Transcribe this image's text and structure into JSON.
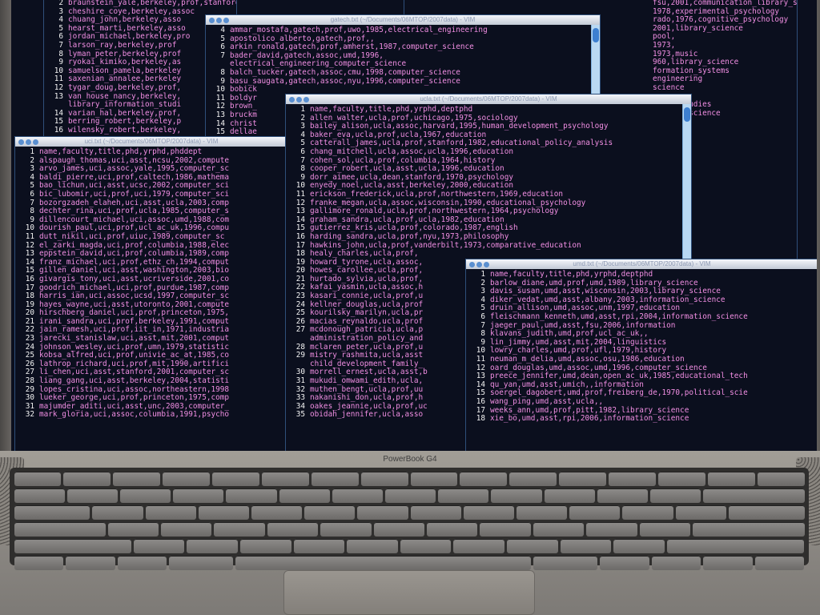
{
  "brand": "PowerBook G4",
  "windows": {
    "top_left": {
      "lines": [
        {
          "n": "2",
          "t": "braunstein_yale,berkeley,prof,stanford,1975,economics"
        },
        {
          "n": "3",
          "t": "cheshire_coye,berkeley,assoc"
        },
        {
          "n": "4",
          "t": "chuang_john,berkeley,asso"
        },
        {
          "n": "5",
          "t": "hearst_marti,berkeley,asso"
        },
        {
          "n": "6",
          "t": "jordan_michael,berkeley,pro"
        },
        {
          "n": "7",
          "t": "larson_ray,berkeley,prof"
        },
        {
          "n": "8",
          "t": "lyman_peter,berkeley,prof"
        },
        {
          "n": "9",
          "t": "ryokai_kimiko,berkeley,as"
        },
        {
          "n": "10",
          "t": "samuelson_pamela,berkeley"
        },
        {
          "n": "11",
          "t": "saxenian_annalee,berkeley"
        },
        {
          "n": "12",
          "t": "tygar_doug,berkeley,prof,"
        },
        {
          "n": "13",
          "t": "van_house_nancy,berkeley,"
        },
        {
          "n": "",
          "t": "library_information_studi"
        },
        {
          "n": "14",
          "t": "varian_hal,berkeley,prof,"
        },
        {
          "n": "15",
          "t": "berring_robert,berkeley,p"
        },
        {
          "n": "16",
          "t": "wilensky_robert,berkeley,"
        }
      ]
    },
    "top_right": {
      "lines": [
        {
          "n": "",
          "t": "fsu,2001,communication_library_science"
        },
        {
          "n": "",
          "t": "1978,experimental_psychology"
        },
        {
          "n": "",
          "t": "rado,1976,cognitive_psychology"
        },
        {
          "n": "",
          "t": "2001,library_science"
        },
        {
          "n": "",
          "t": "pool,"
        },
        {
          "n": "",
          "t": "1973,"
        },
        {
          "n": "",
          "t": "1973,music"
        },
        {
          "n": "",
          "t": "960,library_science"
        },
        {
          "n": "",
          "t": "formation_systems"
        },
        {
          "n": "",
          "t": "engineering"
        },
        {
          "n": "",
          "t": "science"
        },
        {
          "n": "",
          "t": "ce"
        },
        {
          "n": "",
          "t": ""
        },
        {
          "n": "",
          "t": "ation_studies"
        },
        {
          "n": "",
          "t": "library_science"
        },
        {
          "n": "",
          "t": "ence"
        },
        {
          "n": "",
          "t": ""
        },
        {
          "n": "",
          "t": ""
        },
        {
          "n": "",
          "t": ""
        },
        {
          "n": "",
          "t": "ce"
        },
        {
          "n": "",
          "t": "sophy"
        },
        {
          "n": "",
          "t": "ence"
        },
        {
          "n": "",
          "t": "science"
        }
      ]
    },
    "gatech": {
      "title": "gatech.txt (~/Documents/06MTOP/2007data) - VIM",
      "lines": [
        {
          "n": "4",
          "t": "ammar_mostafa,gatech,prof,uwo,1985,electrical_engineering"
        },
        {
          "n": "5",
          "t": "apostolico_alberto,gatech,prof,,"
        },
        {
          "n": "6",
          "t": "arkin_ronald,gatech,prof,amherst,1987,computer_science"
        },
        {
          "n": "7",
          "t": "bader_david,gatech,assoc,umd,1996,"
        },
        {
          "n": "",
          "t": "electrical_engineering_computer_science"
        },
        {
          "n": "8",
          "t": "balch_tucker,gatech,assoc,cmu,1998,computer_science"
        },
        {
          "n": "9",
          "t": "basu_saugata,gatech,assoc,nyu,1996,computer_science"
        },
        {
          "n": "10",
          "t": "bobick"
        },
        {
          "n": "11",
          "t": "boldyr"
        },
        {
          "n": "12",
          "t": "brown_"
        },
        {
          "n": "13",
          "t": "bruckm"
        },
        {
          "n": "14",
          "t": "christ"
        },
        {
          "n": "15",
          "t": "dellae"
        }
      ]
    },
    "uci": {
      "title": "uci.txt (~/Documents/06MTOP/2007data) - VIM",
      "lines": [
        {
          "n": "1",
          "t": "name,faculty,title,phd,yrphd,phddept"
        },
        {
          "n": "2",
          "t": "alspaugh_thomas,uci,asst,ncsu,2002,compute"
        },
        {
          "n": "3",
          "t": "arvo_james,uci,assoc,yale,1995,computer_sc"
        },
        {
          "n": "4",
          "t": "baldi_pierre,uci,prof,caltech,1986,mathema"
        },
        {
          "n": "5",
          "t": "bao_lichun,uci,asst,ucsc,2002,computer_sci"
        },
        {
          "n": "6",
          "t": "bic_lubomir,uci,prof,uci,1979,computer_sci"
        },
        {
          "n": "7",
          "t": "bozorgzadeh_elaheh,uci,asst,ucla,2003,comp"
        },
        {
          "n": "8",
          "t": "dechter_rina,uci,prof,ucla,1985,computer_s"
        },
        {
          "n": "9",
          "t": "dillencourt_michael,uci,assoc,umd,1988,com"
        },
        {
          "n": "10",
          "t": "dourish_paul,uci,prof,ucl_ac_uk,1996,compu"
        },
        {
          "n": "11",
          "t": "dutt_nikil,uci,prof,uiuc,1989,computer_sc"
        },
        {
          "n": "12",
          "t": "el_zarki_magda,uci,prof,columbia,1988,elec"
        },
        {
          "n": "13",
          "t": "eppstein_david,uci,prof,columbia,1989,comp"
        },
        {
          "n": "14",
          "t": "franz_michael,uci,prof,ethz_ch,1994,comput"
        },
        {
          "n": "15",
          "t": "gillen_daniel,uci,asst,washington,2003,bio"
        },
        {
          "n": "16",
          "t": "givargis_tony,uci,asst,ucriverside,2001,co"
        },
        {
          "n": "17",
          "t": "goodrich_michael,uci,prof,purdue,1987,comp"
        },
        {
          "n": "18",
          "t": "harris_ian,uci,assoc,ucsd,1997,computer_sc"
        },
        {
          "n": "19",
          "t": "hayes_wayne,uci,asst,utoronto,2001,compute"
        },
        {
          "n": "20",
          "t": "hirschberg_daniel,uci,prof,princeton,1975,"
        },
        {
          "n": "21",
          "t": "irani_sandra,uci,prof,berkeley,1991,comput"
        },
        {
          "n": "22",
          "t": "jain_ramesh,uci,prof,iit_in,1971,industria"
        },
        {
          "n": "23",
          "t": "jarecki_stanislaw,uci,asst,mit,2001,comput"
        },
        {
          "n": "24",
          "t": "johnson_wesley,uci,prof,umn,1979,statistic"
        },
        {
          "n": "25",
          "t": "kobsa_alfred,uci,prof,univie_ac_at,1985,co"
        },
        {
          "n": "26",
          "t": "lathrop_richard,uci,prof,mit,1990,artifici"
        },
        {
          "n": "27",
          "t": "li_chen,uci,asst,stanford,2001,computer_sc"
        },
        {
          "n": "28",
          "t": "liang_gang,uci,asst,berkeley,2004,statisti"
        },
        {
          "n": "29",
          "t": "lopes_cristina,uci,assoc,northeastern,1998"
        },
        {
          "n": "30",
          "t": "lueker_george,uci,prof,princeton,1975,comp"
        },
        {
          "n": "31",
          "t": "majumder_aditi,uci,asst,unc,2003,computer_"
        },
        {
          "n": "32",
          "t": "mark_gloria,uci,assoc,columbia,1991,psycho"
        }
      ]
    },
    "ucla": {
      "title": "ucla.txt (~/Documents/06MTOP/2007data) - VIM",
      "lines": [
        {
          "n": "1",
          "t": "name,faculty,title,phd,yrphd,deptphd"
        },
        {
          "n": "2",
          "t": "allen_walter,ucla,prof,uchicago,1975,sociology"
        },
        {
          "n": "3",
          "t": "bailey_alison,ucla,assoc,harvard,1995,human_development_psychology"
        },
        {
          "n": "4",
          "t": "baker_eva,ucla,prof,ucla,1967,education"
        },
        {
          "n": "5",
          "t": "catterall_james,ucla,prof,stanford,1982,educational_policy_analysis"
        },
        {
          "n": "6",
          "t": "chang_mitchell,ucla,assoc,ucla,1996,education"
        },
        {
          "n": "7",
          "t": "cohen_sol,ucla,prof,columbia,1964,history"
        },
        {
          "n": "8",
          "t": "cooper_robert,ucla,asst,ucla,1996,education"
        },
        {
          "n": "9",
          "t": "dorr_aimee,ucla,dean,stanford,1970,psychology"
        },
        {
          "n": "10",
          "t": "enyedy_noel,ucla,asst,berkeley,2000,education"
        },
        {
          "n": "11",
          "t": "erickson_frederick,ucla,prof,northwestern,1969,education"
        },
        {
          "n": "12",
          "t": "franke_megan,ucla,assoc,wisconsin,1990,educational_psychology"
        },
        {
          "n": "13",
          "t": "gallimore_ronald,ucla,prof,northwestern,1964,psychology"
        },
        {
          "n": "14",
          "t": "graham_sandra,ucla,prof,ucla,1982,education"
        },
        {
          "n": "15",
          "t": "gutierrez_kris,ucla,prof,colorado,1987,english"
        },
        {
          "n": "16",
          "t": "harding_sandra,ucla,prof,nyu,1973,philosophy"
        },
        {
          "n": "17",
          "t": "hawkins_john,ucla,prof,vanderbilt,1973,comparative_education"
        },
        {
          "n": "18",
          "t": "healy_charles,ucla,prof,"
        },
        {
          "n": "19",
          "t": "howard_tyrone,ucla,assoc,"
        },
        {
          "n": "20",
          "t": "howes_carollee,ucla,prof,"
        },
        {
          "n": "21",
          "t": "hurtado_sylvia,ucla,prof,"
        },
        {
          "n": "22",
          "t": "kafai_yasmin,ucla,assoc,h"
        },
        {
          "n": "23",
          "t": "kasari_connie,ucla,prof,u"
        },
        {
          "n": "24",
          "t": "kellner_douglas,ucla,prof"
        },
        {
          "n": "25",
          "t": "kourilsky_marilyn,ucla,pr"
        },
        {
          "n": "26",
          "t": "macias_reynaldo,ucla,prof"
        },
        {
          "n": "27",
          "t": "mcdonough_patricia,ucla,p"
        },
        {
          "n": "",
          "t": "administration_policy_and"
        },
        {
          "n": "28",
          "t": "mclaren_peter,ucla,prof,u"
        },
        {
          "n": "29",
          "t": "mistry_rashmita,ucla,asst"
        },
        {
          "n": "",
          "t": "child_development_family_"
        },
        {
          "n": "30",
          "t": "morrell_ernest,ucla,asst,b"
        },
        {
          "n": "31",
          "t": "mukudi_omwami_edith,ucla,"
        },
        {
          "n": "32",
          "t": "muthen_bengt,ucla,prof,uu"
        },
        {
          "n": "33",
          "t": "nakanishi_don,ucla,prof,h"
        },
        {
          "n": "34",
          "t": "oakes_jeannie,ucla,prof,uc"
        },
        {
          "n": "35",
          "t": "obidah_jennifer,ucla,asso"
        }
      ]
    },
    "umd": {
      "title": "umd.txt (~/Documents/06MTOP/2007data) - VIM",
      "lines": [
        {
          "n": "1",
          "t": "name,faculty,title,phd,yrphd,deptphd"
        },
        {
          "n": "2",
          "t": "barlow_diane,umd,prof,umd,1989,library_science"
        },
        {
          "n": "3",
          "t": "davis_susan,umd,asst,wisconsin,2003,library_science"
        },
        {
          "n": "4",
          "t": "diker_vedat,umd,asst,albany,2003,information_science"
        },
        {
          "n": "5",
          "t": "druin_allison,umd,assoc,unm,1997,education"
        },
        {
          "n": "6",
          "t": "fleischmann_kenneth,umd,asst,rpi,2004,information_science"
        },
        {
          "n": "7",
          "t": "jaeger_paul,umd,asst,fsu,2006,information"
        },
        {
          "n": "8",
          "t": "klavans_judith,umd,prof,ucl_ac_uk,,"
        },
        {
          "n": "9",
          "t": "lin_jimmy,umd,asst,mit,2004,linguistics"
        },
        {
          "n": "10",
          "t": "lowry_charles,umd,prof,ufl,1979,history"
        },
        {
          "n": "11",
          "t": "neuman_m_delia,umd,assoc,osu,1986,education"
        },
        {
          "n": "12",
          "t": "oard_douglas,umd,assoc,umd,1996,computer_science"
        },
        {
          "n": "13",
          "t": "preece_jennifer,umd,dean,open_ac_uk,1985,educational_tech"
        },
        {
          "n": "14",
          "t": "qu_yan,umd,asst,umich,,information"
        },
        {
          "n": "15",
          "t": "soergel_dagobert,umd,prof,freiberg_de,1970,political_scie"
        },
        {
          "n": "16",
          "t": "wang_ping,umd,asst,ucla,,"
        },
        {
          "n": "17",
          "t": "weeks_ann,umd,prof,pitt,1982,library_science"
        },
        {
          "n": "18",
          "t": "xie_bo,umd,asst,rpi,2006,information_science"
        }
      ]
    }
  }
}
